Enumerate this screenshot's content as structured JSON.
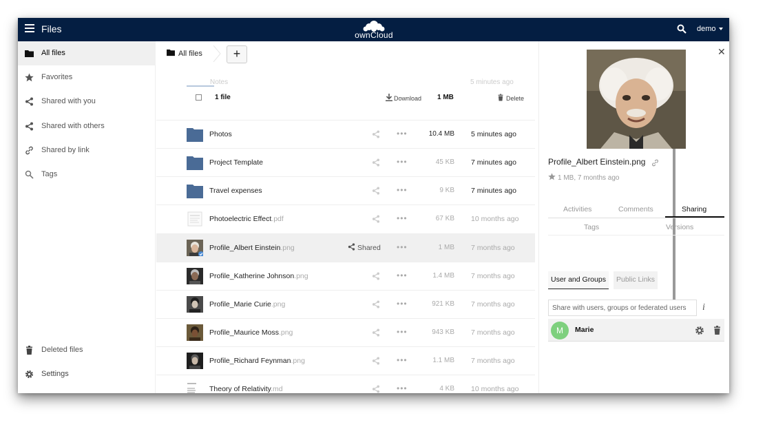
{
  "topbar": {
    "app_title": "Files",
    "logo_text": "ownCloud",
    "user": "demo"
  },
  "sidebar": {
    "items": [
      {
        "label": "All files",
        "icon": "folder-icon"
      },
      {
        "label": "Favorites",
        "icon": "star-icon"
      },
      {
        "label": "Shared with you",
        "icon": "share-icon"
      },
      {
        "label": "Shared with others",
        "icon": "share-icon"
      },
      {
        "label": "Shared by link",
        "icon": "link-icon"
      },
      {
        "label": "Tags",
        "icon": "search-icon"
      }
    ],
    "bottom": [
      {
        "label": "Deleted files",
        "icon": "trash-icon"
      },
      {
        "label": "Settings",
        "icon": "gear-icon"
      }
    ]
  },
  "breadcrumb": {
    "label": "All files",
    "add_label": "+"
  },
  "list_header": {
    "count": "1 file",
    "download": "Download",
    "size": "1 MB",
    "delete": "Delete",
    "ghost_name": "Notes",
    "ghost_time": "5 minutes ago"
  },
  "files": [
    {
      "name": "Photos",
      "ext": "",
      "type": "folder",
      "size": "10.4 MB",
      "time": "5 minutes ago"
    },
    {
      "name": "Project Template",
      "ext": "",
      "type": "folder",
      "size": "45 KB",
      "time": "7 minutes ago"
    },
    {
      "name": "Travel expenses",
      "ext": "",
      "type": "folder",
      "size": "9 KB",
      "time": "7 minutes ago"
    },
    {
      "name": "Photoelectric Effect",
      "ext": ".pdf",
      "type": "doc",
      "size": "67 KB",
      "time": "10 months ago"
    },
    {
      "name": "Profile_Albert Einstein",
      "ext": ".png",
      "type": "photo",
      "size": "1 MB",
      "time": "7 months ago",
      "shared_label": "Shared"
    },
    {
      "name": "Profile_Katherine Johnson",
      "ext": ".png",
      "type": "photo",
      "size": "1.4 MB",
      "time": "7 months ago"
    },
    {
      "name": "Profile_Marie Curie",
      "ext": ".png",
      "type": "photo",
      "size": "921 KB",
      "time": "7 months ago"
    },
    {
      "name": "Profile_Maurice Moss",
      "ext": ".png",
      "type": "photo",
      "size": "943 KB",
      "time": "7 months ago"
    },
    {
      "name": "Profile_Richard Feynman",
      "ext": ".png",
      "type": "photo",
      "size": "1.1 MB",
      "time": "7 months ago"
    },
    {
      "name": "Theory of Relativity",
      "ext": ".md",
      "type": "doc",
      "size": "4 KB",
      "time": "10 months ago"
    }
  ],
  "details": {
    "file_name": "Profile_Albert Einstein.png",
    "meta": "1 MB, 7 months ago",
    "tabs": [
      "Activities",
      "Comments",
      "Sharing"
    ],
    "tabs2": [
      "Tags",
      "Versions"
    ],
    "subtabs": [
      "User and Groups",
      "Public Links"
    ],
    "share_placeholder": "Share with users, groups or federated users",
    "info": "i",
    "shares": [
      {
        "initial": "M",
        "name": "Marie"
      }
    ]
  },
  "colors": {
    "topbar": "#041e42",
    "folder": "#4a6b96",
    "avatar": "#7ed07e"
  }
}
